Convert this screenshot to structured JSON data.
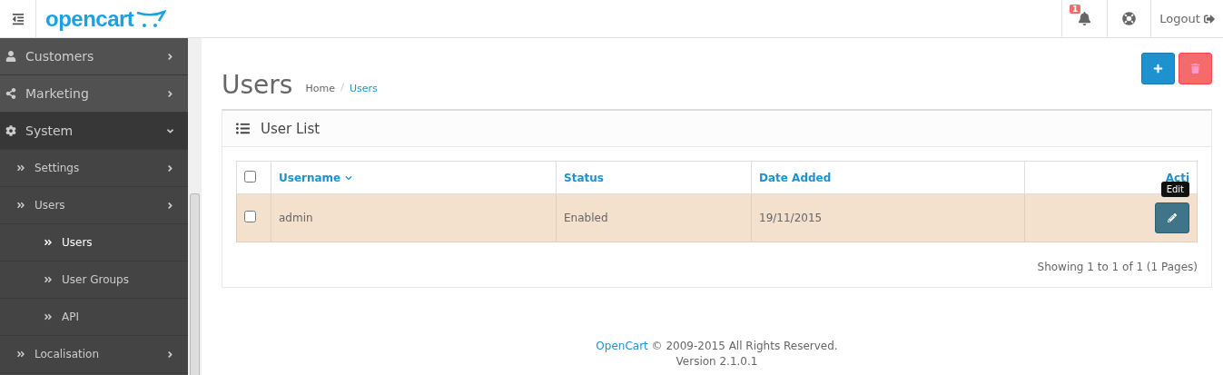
{
  "header": {
    "logo": "opencart",
    "notification_count": "1",
    "logout": "Logout"
  },
  "sidebar": {
    "items": [
      {
        "label": "Customers",
        "expanded": false
      },
      {
        "label": "Marketing",
        "expanded": false
      },
      {
        "label": "System",
        "expanded": true,
        "children": [
          {
            "label": "Settings"
          },
          {
            "label": "Users",
            "expanded": true,
            "children": [
              {
                "label": "Users",
                "selected": true
              },
              {
                "label": "User Groups",
                "selected": false
              },
              {
                "label": "API",
                "selected": false
              }
            ]
          },
          {
            "label": "Localisation"
          }
        ]
      }
    ]
  },
  "page": {
    "title": "Users",
    "breadcrumbs": [
      "Home",
      "Users"
    ]
  },
  "panel": {
    "title": "User List",
    "select_all_checked": false,
    "columns": [
      "Username",
      "Status",
      "Date Added",
      "Acti"
    ],
    "rows": [
      {
        "checked": false,
        "cells": [
          "admin",
          "Enabled",
          "19/11/2015"
        ],
        "tooltip": "Edit"
      }
    ],
    "pagination": "Showing 1 to 1 of 1 (1 Pages)"
  },
  "footer": {
    "brand": "OpenCart",
    "copyright": "© 2009-2015 All Rights Reserved.",
    "version": "Version 2.1.0.1"
  }
}
